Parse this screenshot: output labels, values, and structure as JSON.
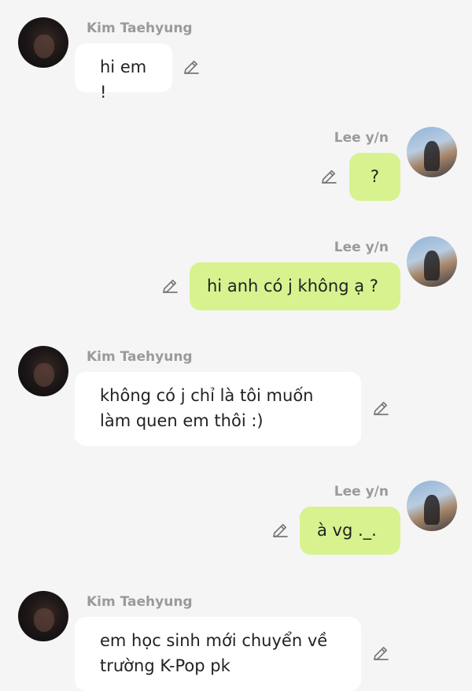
{
  "messages": [
    {
      "sender": "Kim Taehyung",
      "text": "hi em !",
      "side": "left"
    },
    {
      "sender": "Lee y/n",
      "text": "?",
      "side": "right"
    },
    {
      "sender": "Lee y/n",
      "text": "hi anh có j không ạ ?",
      "side": "right"
    },
    {
      "sender": "Kim Taehyung",
      "text": "không có j chỉ là tôi muốn\nlàm quen em thôi :)",
      "side": "left"
    },
    {
      "sender": "Lee y/n",
      "text": "à vg ._.",
      "side": "right"
    },
    {
      "sender": "Kim Taehyung",
      "text": "em học sinh mới chuyển về\ntrường K-Pop pk",
      "side": "left"
    }
  ],
  "icons": {
    "avatar_left": "avatar-photo",
    "avatar_right": "avatar-photo",
    "edit": "pencil-icon"
  },
  "colors": {
    "background": "#f5f5f5",
    "left_bubble": "#ffffff",
    "right_bubble": "#d7f28f",
    "sender_name": "#9a9a9a"
  }
}
